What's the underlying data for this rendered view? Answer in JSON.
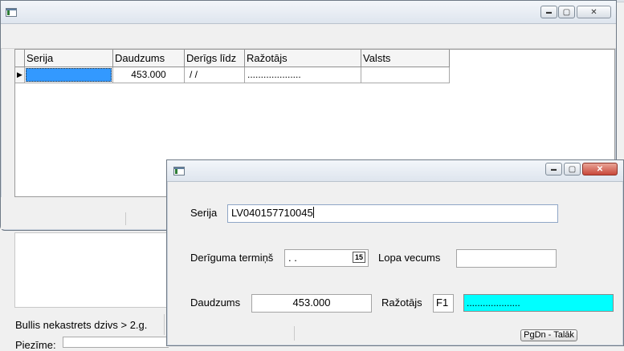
{
  "background_window": {
    "status_text": "Bullis nekastrets  dzivs > 2.g.",
    "field_label": "Piezīme:"
  },
  "grid_window": {
    "title": "",
    "controls": {
      "minimize": "▬",
      "maximize": "▢",
      "close": "✕"
    },
    "columns": [
      "Serija",
      "Daudzums",
      "Derīgs līdz",
      "Ražotājs",
      "Valsts"
    ],
    "rows": [
      {
        "serija": "",
        "daudzums": "453.000",
        "derigs_lidz": " /  /",
        "razotajs": "....................",
        "valsts": ""
      }
    ],
    "row_indicator": "▶"
  },
  "dialog": {
    "title": "",
    "controls": {
      "minimize": "▬",
      "maximize": "▢",
      "close": "✕"
    },
    "serija_label": "Serija",
    "serija_value": "LV040157710045",
    "deriguma_label": "Derīguma termiņš",
    "deriguma_value": " .  .",
    "calendar_glyph": "15",
    "lopa_label": "Lopa vecums",
    "lopa_value": "",
    "daudzums_label": "Daudzums",
    "daudzums_value": "453.000",
    "razotajs_label": "Ražotājs",
    "razotajs_code": "F1",
    "razotajs_name": "....................",
    "pgdn_label": "PgDn - Talāk"
  },
  "colors": {
    "selected_cell": "#3399ff",
    "razotajs_highlight": "#00ffff"
  }
}
